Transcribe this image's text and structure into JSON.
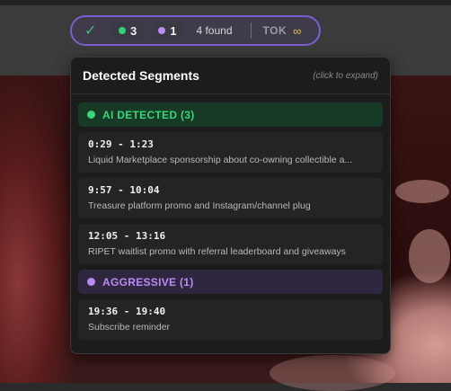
{
  "toolbar": {
    "check_icon": "check-icon",
    "ai_count": "3",
    "ai_color": "#33d17a",
    "aggressive_count": "1",
    "aggressive_color": "#b98cf2",
    "found_text": "4 found",
    "tok_label": "TOK",
    "infinity_symbol": "∞"
  },
  "panel": {
    "title": "Detected Segments",
    "hint": "(click to expand)",
    "groups": [
      {
        "label": "AI DETECTED (3)",
        "color": "#3ad47a",
        "segments": [
          {
            "time": "0:29 - 1:23",
            "desc": "Liquid Marketplace sponsorship about co-owning collectible a..."
          },
          {
            "time": "9:57 - 10:04",
            "desc": "Treasure platform promo and Instagram/channel plug"
          },
          {
            "time": "12:05 - 13:16",
            "desc": "RIPET waitlist promo with referral leaderboard and giveaways"
          }
        ]
      },
      {
        "label": "AGGRESSIVE (1)",
        "color": "#b98cf2",
        "segments": [
          {
            "time": "19:36 - 19:40",
            "desc": "Subscribe reminder"
          }
        ]
      }
    ]
  }
}
